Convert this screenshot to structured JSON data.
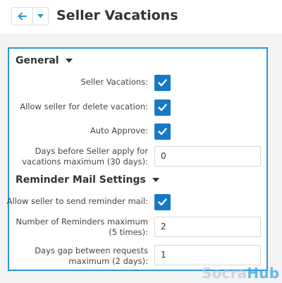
{
  "header": {
    "title": "Seller Vacations",
    "back_icon": "arrow-left-icon",
    "dropdown_icon": "caret-down-icon"
  },
  "general": {
    "title": "General",
    "fields": [
      {
        "label": "Seller Vacations:",
        "type": "checkbox",
        "checked": true
      },
      {
        "label": "Allow seller for delete vacation:",
        "type": "checkbox",
        "checked": true
      },
      {
        "label": "Auto Approve:",
        "type": "checkbox",
        "checked": true
      },
      {
        "label_lines": [
          "Days before Seller apply for",
          "vacations maximum (30 days):"
        ],
        "type": "text",
        "value": "0"
      }
    ]
  },
  "reminder": {
    "title": "Reminder Mail Settings",
    "fields": [
      {
        "label": "Allow seller to send reminder mail:",
        "type": "checkbox",
        "checked": true
      },
      {
        "label_lines": [
          "Number of Reminders maximum",
          "(5 times):"
        ],
        "type": "text",
        "value": "2"
      },
      {
        "label_lines": [
          "Days gap between requests",
          "maximum (2 days):"
        ],
        "type": "text",
        "value": "1"
      }
    ]
  },
  "watermark": {
    "part1": "Socra",
    "part2": "Hub"
  },
  "colors": {
    "accent": "#2b95d8",
    "checkbox": "#1679c4",
    "back_arrow": "#2b95d8"
  }
}
